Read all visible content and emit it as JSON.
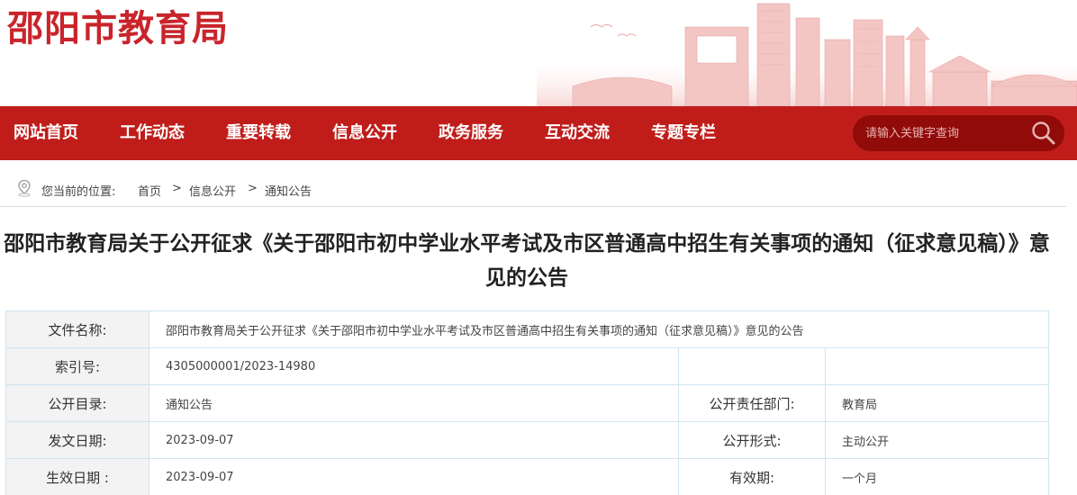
{
  "header": {
    "logo_text": "邵阳市教育局"
  },
  "nav": {
    "items": [
      {
        "label": "网站首页"
      },
      {
        "label": "工作动态"
      },
      {
        "label": "重要转载"
      },
      {
        "label": "信息公开"
      },
      {
        "label": "政务服务"
      },
      {
        "label": "互动交流"
      },
      {
        "label": "专题专栏"
      }
    ],
    "search_placeholder": "请输入关键字查询"
  },
  "breadcrumb": {
    "prefix": "您当前的位置:",
    "items": [
      "首页",
      "信息公开",
      "通知公告"
    ],
    "separator": ">"
  },
  "article": {
    "title": "邵阳市教育局关于公开征求《关于邵阳市初中学业水平考试及市区普通高中招生有关事项的通知（征求意见稿）》意见的公告"
  },
  "info": {
    "file_name_label": "文件名称:",
    "file_name_value": "邵阳市教育局关于公开征求《关于邵阳市初中学业水平考试及市区普通高中招生有关事项的通知（征求意见稿）》意见的公告",
    "index_label": "索引号:",
    "index_value": "4305000001/2023-14980",
    "catalog_label": "公开目录:",
    "catalog_value": "通知公告",
    "dept_label": "公开责任部门:",
    "dept_value": "教育局",
    "issue_date_label": "发文日期:",
    "issue_date_value": "2023-09-07",
    "form_label": "公开形式:",
    "form_value": "主动公开",
    "effective_date_label": "生效日期 :",
    "effective_date_value": "2023-09-07",
    "validity_label": "有效期:",
    "validity_value": "一个月"
  },
  "colors": {
    "brand_red": "#c01d1a",
    "logo_red": "#c9242b",
    "search_bg": "#900b0a"
  }
}
